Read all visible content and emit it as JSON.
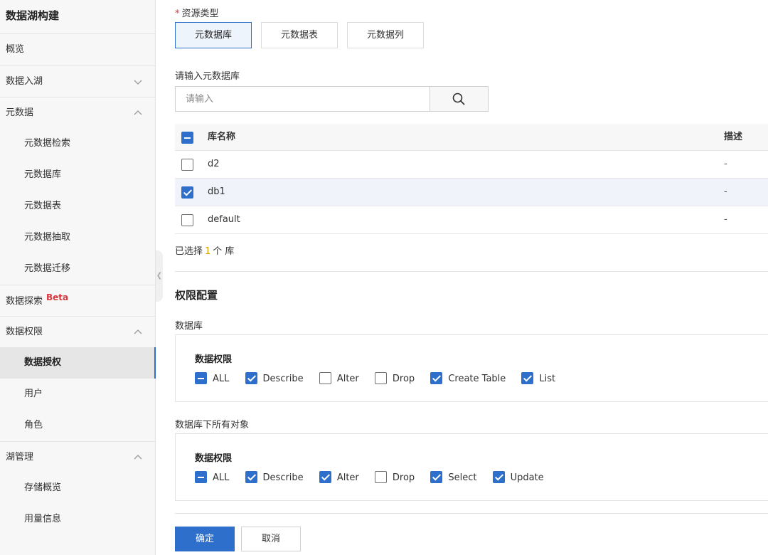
{
  "sidebar": {
    "title": "数据湖构建",
    "items": [
      {
        "label": "概览"
      },
      {
        "label": "数据入湖"
      },
      {
        "label": "元数据"
      },
      {
        "label": "元数据检索"
      },
      {
        "label": "元数据库"
      },
      {
        "label": "元数据表"
      },
      {
        "label": "元数据抽取"
      },
      {
        "label": "元数据迁移"
      },
      {
        "label": "数据探索",
        "badge": "Beta"
      },
      {
        "label": "数据权限"
      },
      {
        "label": "数据授权"
      },
      {
        "label": "用户"
      },
      {
        "label": "角色"
      },
      {
        "label": "湖管理"
      },
      {
        "label": "存储概览"
      },
      {
        "label": "用量信息"
      }
    ]
  },
  "form": {
    "resource_type_label": "资源类型",
    "resource_types": [
      "元数据库",
      "元数据表",
      "元数据列"
    ],
    "selected_resource_type": "元数据库",
    "search_label": "请输入元数据库",
    "search_placeholder": "请输入"
  },
  "table": {
    "col_name": "库名称",
    "col_desc": "描述",
    "rows": [
      {
        "name": "d2",
        "desc": "-",
        "checked": false
      },
      {
        "name": "db1",
        "desc": "-",
        "checked": true
      },
      {
        "name": "default",
        "desc": "-",
        "checked": false
      }
    ]
  },
  "selection": {
    "prefix": "已选择",
    "count": "1",
    "suffix": "个 库"
  },
  "permissions": {
    "title": "权限配置",
    "database": {
      "section_label": "数据库",
      "box_title": "数据权限",
      "options": [
        {
          "label": "ALL",
          "state": "indeterminate"
        },
        {
          "label": "Describe",
          "state": "checked"
        },
        {
          "label": "Alter",
          "state": "unchecked"
        },
        {
          "label": "Drop",
          "state": "unchecked"
        },
        {
          "label": "Create Table",
          "state": "checked"
        },
        {
          "label": "List",
          "state": "checked"
        }
      ]
    },
    "objects": {
      "section_label": "数据库下所有对象",
      "box_title": "数据权限",
      "options": [
        {
          "label": "ALL",
          "state": "indeterminate"
        },
        {
          "label": "Describe",
          "state": "checked"
        },
        {
          "label": "Alter",
          "state": "checked"
        },
        {
          "label": "Drop",
          "state": "unchecked"
        },
        {
          "label": "Select",
          "state": "checked"
        },
        {
          "label": "Update",
          "state": "checked"
        }
      ]
    }
  },
  "actions": {
    "confirm": "确定",
    "cancel": "取消"
  },
  "colors": {
    "accent": "#2d6fcb",
    "required": "#d9363e",
    "count": "#d9a000"
  }
}
